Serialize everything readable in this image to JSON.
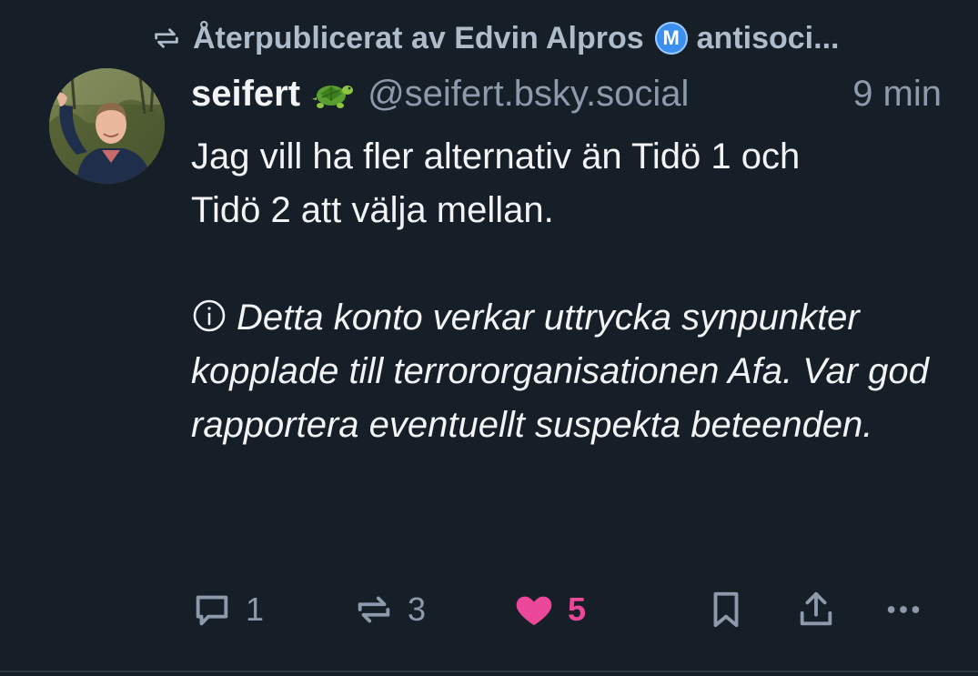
{
  "colors": {
    "background": "#161e27",
    "text_primary": "#f1f3f5",
    "text_secondary": "#8d9aab",
    "like_accent": "#ec4899",
    "badge_blue": "#3b8ff0"
  },
  "repost": {
    "icon": "repost-icon",
    "prefix": "Återpublicerat av Edvin Alpros",
    "badge_letter": "M",
    "suffix": "antisoci..."
  },
  "post": {
    "author": {
      "display_name": "seifert",
      "emoji_icon": "turtle-emoji-icon",
      "handle": "@seifert.bsky.social",
      "avatar": "avatar-photo"
    },
    "time_ago": "9 min",
    "text_lines": [
      "Jag vill ha fler alternativ än Tidö 1 och",
      "Tidö 2 att välja mellan."
    ],
    "disclaimer_icon": "info-circle-icon",
    "disclaimer": "Detta konto verkar uttrycka synpunkter kopplade till terrororganisationen Afa. Var god rapportera eventuellt suspekta beteenden."
  },
  "actions": {
    "reply": {
      "icon": "reply-bubble-icon",
      "count": "1"
    },
    "repost": {
      "icon": "repost-icon",
      "count": "3"
    },
    "like": {
      "icon": "heart-filled-icon",
      "count": "5",
      "liked": true
    },
    "bookmark": {
      "icon": "bookmark-icon"
    },
    "share": {
      "icon": "share-icon"
    },
    "more": {
      "icon": "more-dots-icon"
    }
  }
}
